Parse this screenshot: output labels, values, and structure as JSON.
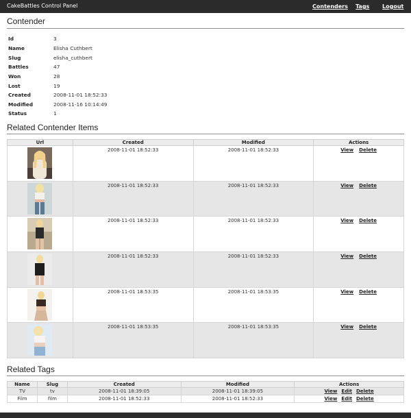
{
  "header": {
    "app_title": "CakeBattles Control Panel",
    "nav": [
      "Contenders",
      "Tags",
      "Logout"
    ]
  },
  "contender": {
    "heading": "Contender",
    "fields": [
      {
        "label": "Id",
        "value": "3"
      },
      {
        "label": "Name",
        "value": "Elisha Cuthbert"
      },
      {
        "label": "Slug",
        "value": "elisha_cuthbert"
      },
      {
        "label": "Battles",
        "value": "47"
      },
      {
        "label": "Won",
        "value": "28"
      },
      {
        "label": "Lost",
        "value": "19"
      },
      {
        "label": "Created",
        "value": "2008-11-01 18:52:33"
      },
      {
        "label": "Modified",
        "value": "2008-11-16 10:14:49"
      },
      {
        "label": "Status",
        "value": "1"
      }
    ]
  },
  "items": {
    "heading": "Related Contender Items",
    "columns": [
      "Url",
      "Created",
      "Modified",
      "Actions"
    ],
    "rows": [
      {
        "created": "2008-11-01 18:52:33",
        "modified": "2008-11-01 18:52:33",
        "view": "View",
        "delete": "Delete"
      },
      {
        "created": "2008-11-01 18:52:33",
        "modified": "2008-11-01 18:52:33",
        "view": "View",
        "delete": "Delete"
      },
      {
        "created": "2008-11-01 18:52:33",
        "modified": "2008-11-01 18:52:33",
        "view": "View",
        "delete": "Delete"
      },
      {
        "created": "2008-11-01 18:52:33",
        "modified": "2008-11-01 18:52:33",
        "view": "View",
        "delete": "Delete"
      },
      {
        "created": "2008-11-01 18:53:35",
        "modified": "2008-11-01 18:53:35",
        "view": "View",
        "delete": "Delete"
      },
      {
        "created": "2008-11-01 18:53:35",
        "modified": "2008-11-01 18:53:35",
        "view": "View",
        "delete": "Delete"
      }
    ]
  },
  "tags": {
    "heading": "Related Tags",
    "columns": [
      "Name",
      "Slug",
      "Created",
      "Modified",
      "Actions"
    ],
    "rows": [
      {
        "name": "TV",
        "slug": "tv",
        "created": "2008-11-01 18:39:05",
        "modified": "2008-11-01 18:39:05",
        "view": "View",
        "edit": "Edit",
        "delete": "Delete"
      },
      {
        "name": "Film",
        "slug": "film",
        "created": "2008-11-01 18:52:33",
        "modified": "2008-11-01 18:52:33",
        "view": "View",
        "edit": "Edit",
        "delete": "Delete"
      }
    ]
  },
  "colors": {
    "topbar": "#2b2b2b",
    "alt_row": "#e6e6e6",
    "header_row": "#ececec"
  }
}
